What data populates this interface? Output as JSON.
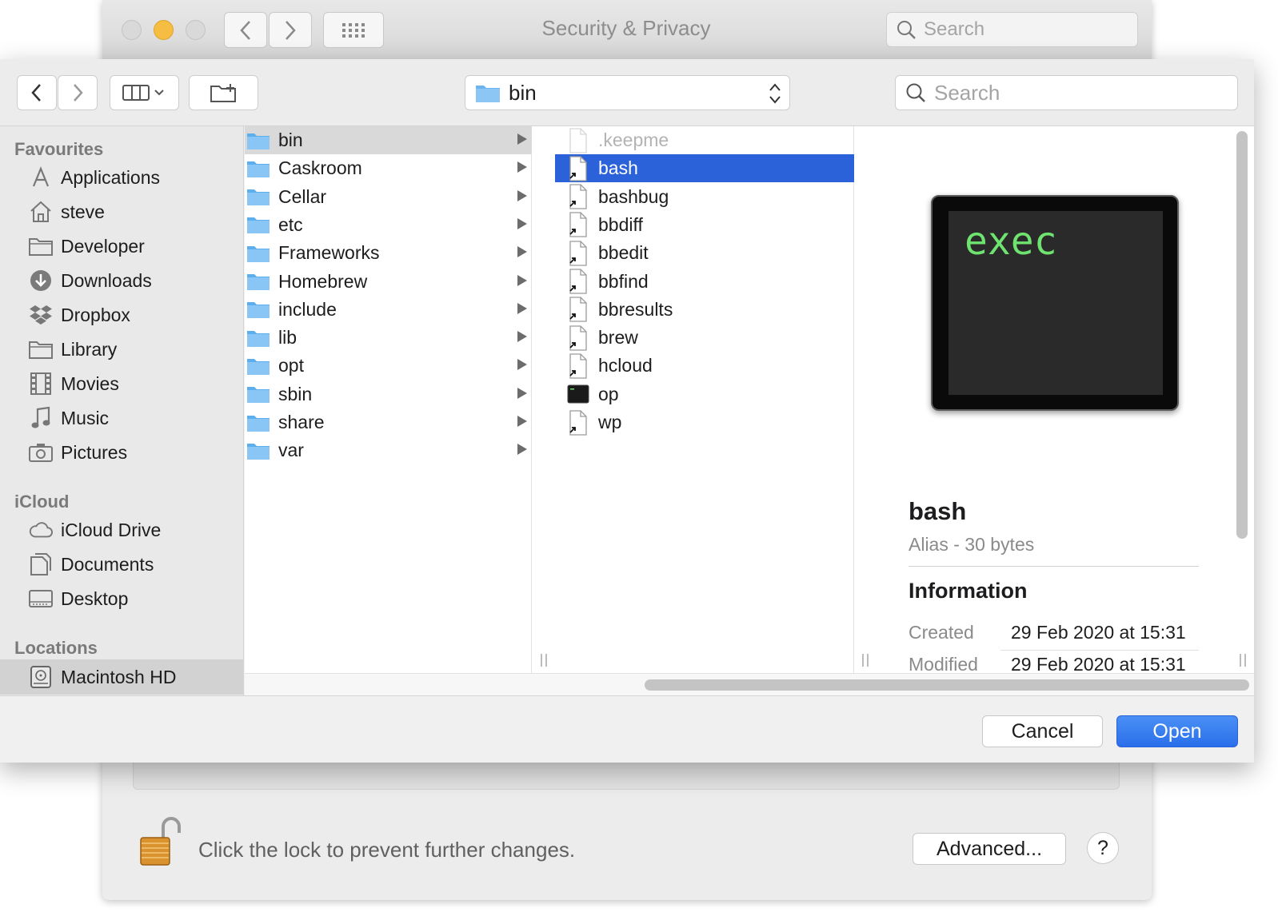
{
  "bg_window": {
    "title": "Security & Privacy",
    "search_placeholder": "Search",
    "lock_text": "Click the lock to prevent further changes.",
    "advanced_label": "Advanced...",
    "help_label": "?"
  },
  "dialog": {
    "path": "bin",
    "search_placeholder": "Search",
    "cancel_label": "Cancel",
    "open_label": "Open"
  },
  "sidebar": {
    "sections": [
      {
        "label": "Favourites",
        "items": [
          {
            "label": "Applications",
            "icon": "applications-icon"
          },
          {
            "label": "steve",
            "icon": "home-icon"
          },
          {
            "label": "Developer",
            "icon": "folder-icon"
          },
          {
            "label": "Downloads",
            "icon": "downloads-icon"
          },
          {
            "label": "Dropbox",
            "icon": "dropbox-icon"
          },
          {
            "label": "Library",
            "icon": "folder-icon"
          },
          {
            "label": "Movies",
            "icon": "movies-icon"
          },
          {
            "label": "Music",
            "icon": "music-icon"
          },
          {
            "label": "Pictures",
            "icon": "camera-icon"
          }
        ]
      },
      {
        "label": "iCloud",
        "items": [
          {
            "label": "iCloud Drive",
            "icon": "cloud-icon"
          },
          {
            "label": "Documents",
            "icon": "documents-icon"
          },
          {
            "label": "Desktop",
            "icon": "desktop-icon"
          }
        ]
      },
      {
        "label": "Locations",
        "items": [
          {
            "label": "Macintosh HD",
            "icon": "hard-drive-icon",
            "selected": true
          }
        ]
      }
    ]
  },
  "column1": {
    "items": [
      "bin",
      "Caskroom",
      "Cellar",
      "etc",
      "Frameworks",
      "Homebrew",
      "include",
      "lib",
      "opt",
      "sbin",
      "share",
      "var"
    ],
    "selected": "bin"
  },
  "column2": {
    "items": [
      ".keepme",
      "bash",
      "bashbug",
      "bbdiff",
      "bbedit",
      "bbfind",
      "bbresults",
      "brew",
      "hcloud",
      "op",
      "wp"
    ],
    "selected": "bash",
    "dimmed": ".keepme",
    "executable": "op"
  },
  "preview": {
    "icon_text": "exec",
    "name": "bash",
    "kind": "Alias - 30 bytes",
    "info_header": "Information",
    "created_label": "Created",
    "created_value": "29 Feb 2020 at 15:31",
    "modified_label": "Modified",
    "modified_value": "29 Feb 2020 at 15:31"
  },
  "colors": {
    "selection_blue": "#2b62d9",
    "open_button": "#2a6fea",
    "folder_blue": "#6cb4f0",
    "terminal_green": "#6fe36f"
  }
}
